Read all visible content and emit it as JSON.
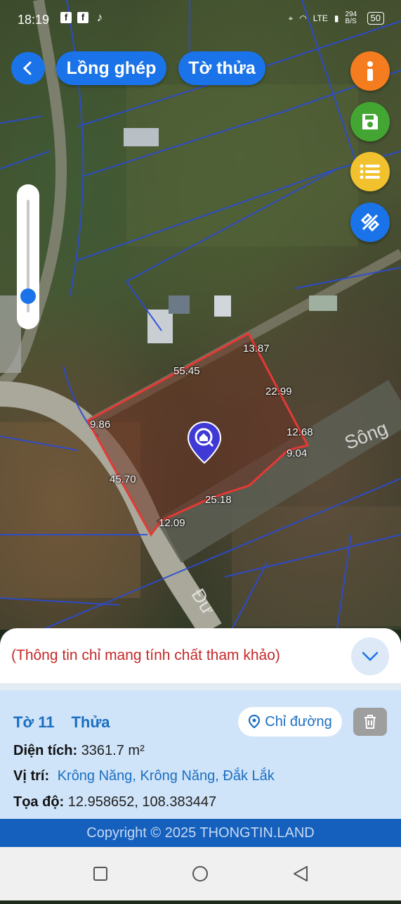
{
  "status_bar": {
    "time": "18:19",
    "network": "LTE",
    "speed": "294 B/S",
    "battery": "50"
  },
  "header": {
    "back_label": "<",
    "overlay_button": "Lồng ghép",
    "parcel_button": "Tờ thửa"
  },
  "fab_colors": {
    "info": "#f57c1f",
    "save": "#43a633",
    "list": "#f2c12e",
    "measure": "#1a73e8"
  },
  "zoom_level": 0.15,
  "map": {
    "edge_lengths": [
      "13.87",
      "55.45",
      "22.99",
      "9.86",
      "12.68",
      "9.04",
      "45.70",
      "25.18",
      "12.09"
    ],
    "road_labels": [
      "Sông",
      "Đư"
    ]
  },
  "sheet": {
    "notice": "(Thông tin chỉ mang tính chất tham khảo)"
  },
  "parcel": {
    "sheet_label": "Tờ 11",
    "parcel_label": "Thửa",
    "route_button": "Chỉ đường",
    "area_label": "Diện tích:",
    "area_value": "3361.7 m²",
    "location_label": "Vị trí:",
    "location_value": "Krông Năng, Krông Năng, Đắk Lắk",
    "coords_label": "Tọa độ:",
    "coords_value": "12.958652, 108.383447"
  },
  "footer": {
    "copyright": "Copyright © 2025 THONGTIN.LAND"
  }
}
